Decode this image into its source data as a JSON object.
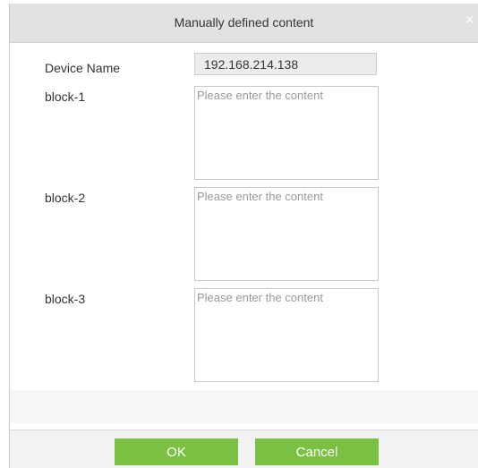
{
  "dialog": {
    "title": "Manually defined content",
    "close_symbol": "×"
  },
  "form": {
    "device_name_label": "Device Name",
    "device_name_value": "192.168.214.138",
    "blocks": [
      {
        "label": "block-1",
        "placeholder": "Please enter the content",
        "value": ""
      },
      {
        "label": "block-2",
        "placeholder": "Please enter the content",
        "value": ""
      },
      {
        "label": "block-3",
        "placeholder": "Please enter the content",
        "value": ""
      }
    ]
  },
  "buttons": {
    "ok_label": "OK",
    "cancel_label": "Cancel"
  },
  "colors": {
    "button_green": "#7ac143",
    "titlebar": "#e2e2e2"
  },
  "icons": {
    "close": "close-icon"
  }
}
